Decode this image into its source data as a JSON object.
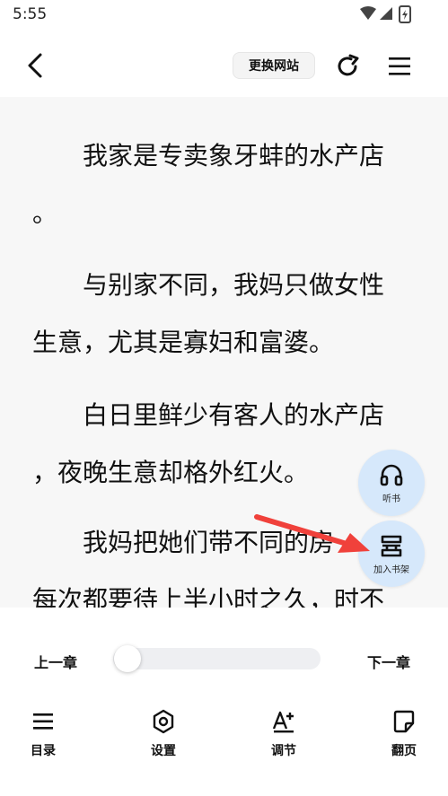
{
  "status_bar": {
    "time": "5:55",
    "icons": [
      "wifi-icon",
      "signal-icon",
      "battery-icon"
    ]
  },
  "top_bar": {
    "back_icon": "chevron-left-icon",
    "change_source_label": "更换网站",
    "refresh_icon": "refresh-icon",
    "menu_icon": "hamburger-menu-icon"
  },
  "reader": {
    "background": "#f7f7f7",
    "paragraphs": [
      {
        "lines": [
          "　　我家是专卖象牙蚌的水产店",
          "。"
        ]
      },
      {
        "lines": [
          "　　与别家不同，我妈只做女性",
          "生意，尤其是寡妇和富婆。"
        ]
      },
      {
        "lines": [
          "　　白日里鲜少有客人的水产店",
          "，夜晚生意却格外红火。"
        ]
      },
      {
        "lines": [
          "　　我妈把她们带不同的房",
          "每次都要待上半小时之久，时不"
        ]
      }
    ]
  },
  "floating_buttons": {
    "listen": {
      "label": "听书",
      "icon": "headphones-icon"
    },
    "add_shelf": {
      "label": "加入书架",
      "icon": "bookshelf-icon"
    },
    "color": "#d6e8fb"
  },
  "annotation": {
    "icon": "red-arrow-icon",
    "color": "#f0413b"
  },
  "bottom_bar": {
    "prev_chapter": "上一章",
    "next_chapter": "下一章",
    "progress": 0,
    "tools": [
      {
        "label": "目录",
        "icon": "list-icon"
      },
      {
        "label": "设置",
        "icon": "settings-hexagon-icon"
      },
      {
        "label": "调节",
        "icon": "font-adjust-icon"
      },
      {
        "label": "翻页",
        "icon": "page-flip-icon"
      }
    ]
  }
}
